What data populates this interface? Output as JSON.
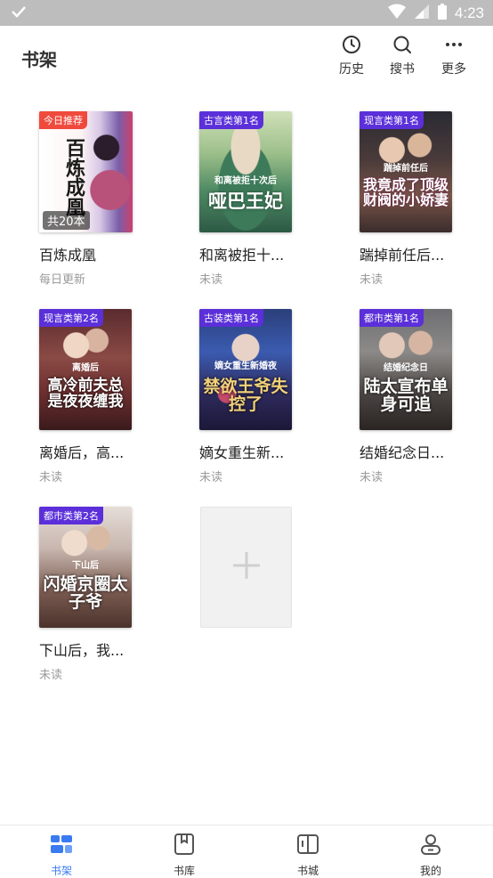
{
  "status_bar": {
    "time": "4:23"
  },
  "header": {
    "title": "书架",
    "actions": [
      {
        "label": "历史",
        "icon": "clock-icon"
      },
      {
        "label": "搜书",
        "icon": "search-icon"
      },
      {
        "label": "更多",
        "icon": "more-icon"
      }
    ]
  },
  "books": [
    {
      "tag": "今日推荐",
      "tag_color": "#f04a3d",
      "title": "百炼成凰",
      "status": "每日更新",
      "count_label": "共20本",
      "cover_text": "百炼成凰"
    },
    {
      "tag": "古言类第1名",
      "tag_color": "#5b2fd9",
      "title": "和离被拒十...",
      "status": "未读",
      "cover_text": "哑巴王妃",
      "cover_subtext": "和离被拒十次后"
    },
    {
      "tag": "现言类第1名",
      "tag_color": "#5b2fd9",
      "title": "踹掉前任后...",
      "status": "未读",
      "cover_text": "我竟成了顶级财阀的小娇妻",
      "cover_subtext": "踹掉前任后"
    },
    {
      "tag": "现言类第2名",
      "tag_color": "#5b2fd9",
      "title": "离婚后，高...",
      "status": "未读",
      "cover_text": "高冷前夫总是夜夜缠我",
      "cover_subtext": "离婚后"
    },
    {
      "tag": "古装类第1名",
      "tag_color": "#5b2fd9",
      "title": "嫡女重生新...",
      "status": "未读",
      "cover_text": "禁欲王爷失控了",
      "cover_subtext": "嫡女重生新婚夜"
    },
    {
      "tag": "都市类第1名",
      "tag_color": "#5b2fd9",
      "title": "结婚纪念日...",
      "status": "未读",
      "cover_text": "陆太宣布单身可追",
      "cover_subtext": "结婚纪念日"
    },
    {
      "tag": "都市类第2名",
      "tag_color": "#5b2fd9",
      "title": "下山后，我...",
      "status": "未读",
      "cover_text": "闪婚京圈太子爷",
      "cover_subtext": "下山后"
    }
  ],
  "bottom_nav": [
    {
      "label": "书架",
      "icon": "bookshelf-icon",
      "active": true
    },
    {
      "label": "书库",
      "icon": "library-icon",
      "active": false
    },
    {
      "label": "书城",
      "icon": "bookstore-icon",
      "active": false
    },
    {
      "label": "我的",
      "icon": "profile-icon",
      "active": false
    }
  ],
  "colors": {
    "accent": "#3a7bf2",
    "tag_purple": "#5b2fd9",
    "tag_red": "#f04a3d"
  }
}
